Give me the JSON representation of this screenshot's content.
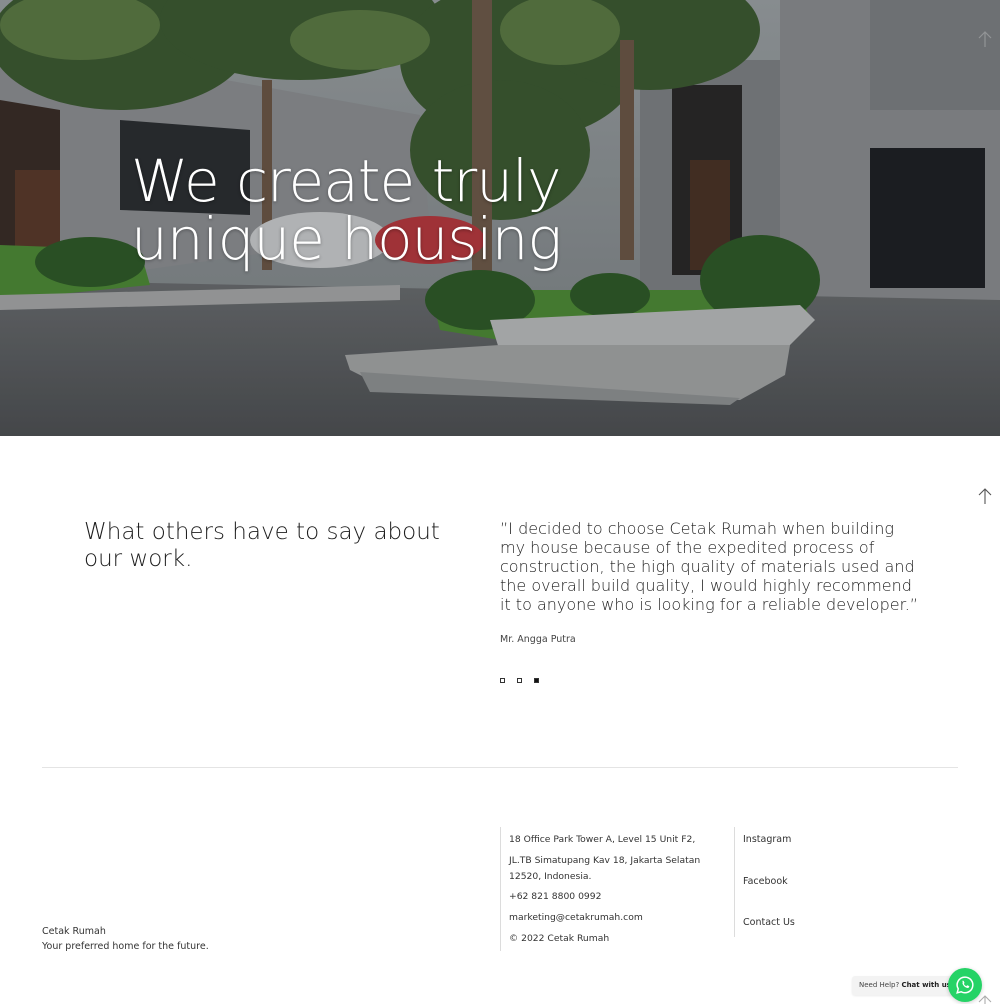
{
  "hero": {
    "title_line1": "We create truly",
    "title_line2": "unique housing"
  },
  "testimonials": {
    "heading": "What others have to say about our work.",
    "quote": "”I decided to choose Cetak Rumah when building my house because of the expedited process of construction, the high quality of materials used and the overall build quality, I would highly recommend it to anyone who is looking for a reliable developer.”",
    "author": "Mr. Angga Putra",
    "slide_count": 3,
    "active_slide": 3
  },
  "footer": {
    "brand_name": "Cetak Rumah",
    "tagline": "Your preferred home for the future.",
    "address_line1": "18 Office Park Tower A, Level 15 Unit F2,",
    "address_line2": "JL.TB Simatupang Kav 18, Jakarta Selatan 12520, Indonesia.",
    "phone": "+62 821 8800 0992",
    "email": "marketing@cetakrumah.com",
    "copyright": "© 2022 Cetak Rumah",
    "links": [
      "Instagram",
      "Facebook",
      "Contact Us"
    ]
  },
  "whatsapp": {
    "help_text": "Need Help?",
    "chat_text": "Chat with us",
    "color": "#25d366"
  },
  "icons": {
    "scroll_top": "arrow-up-icon",
    "whatsapp": "whatsapp-icon"
  }
}
